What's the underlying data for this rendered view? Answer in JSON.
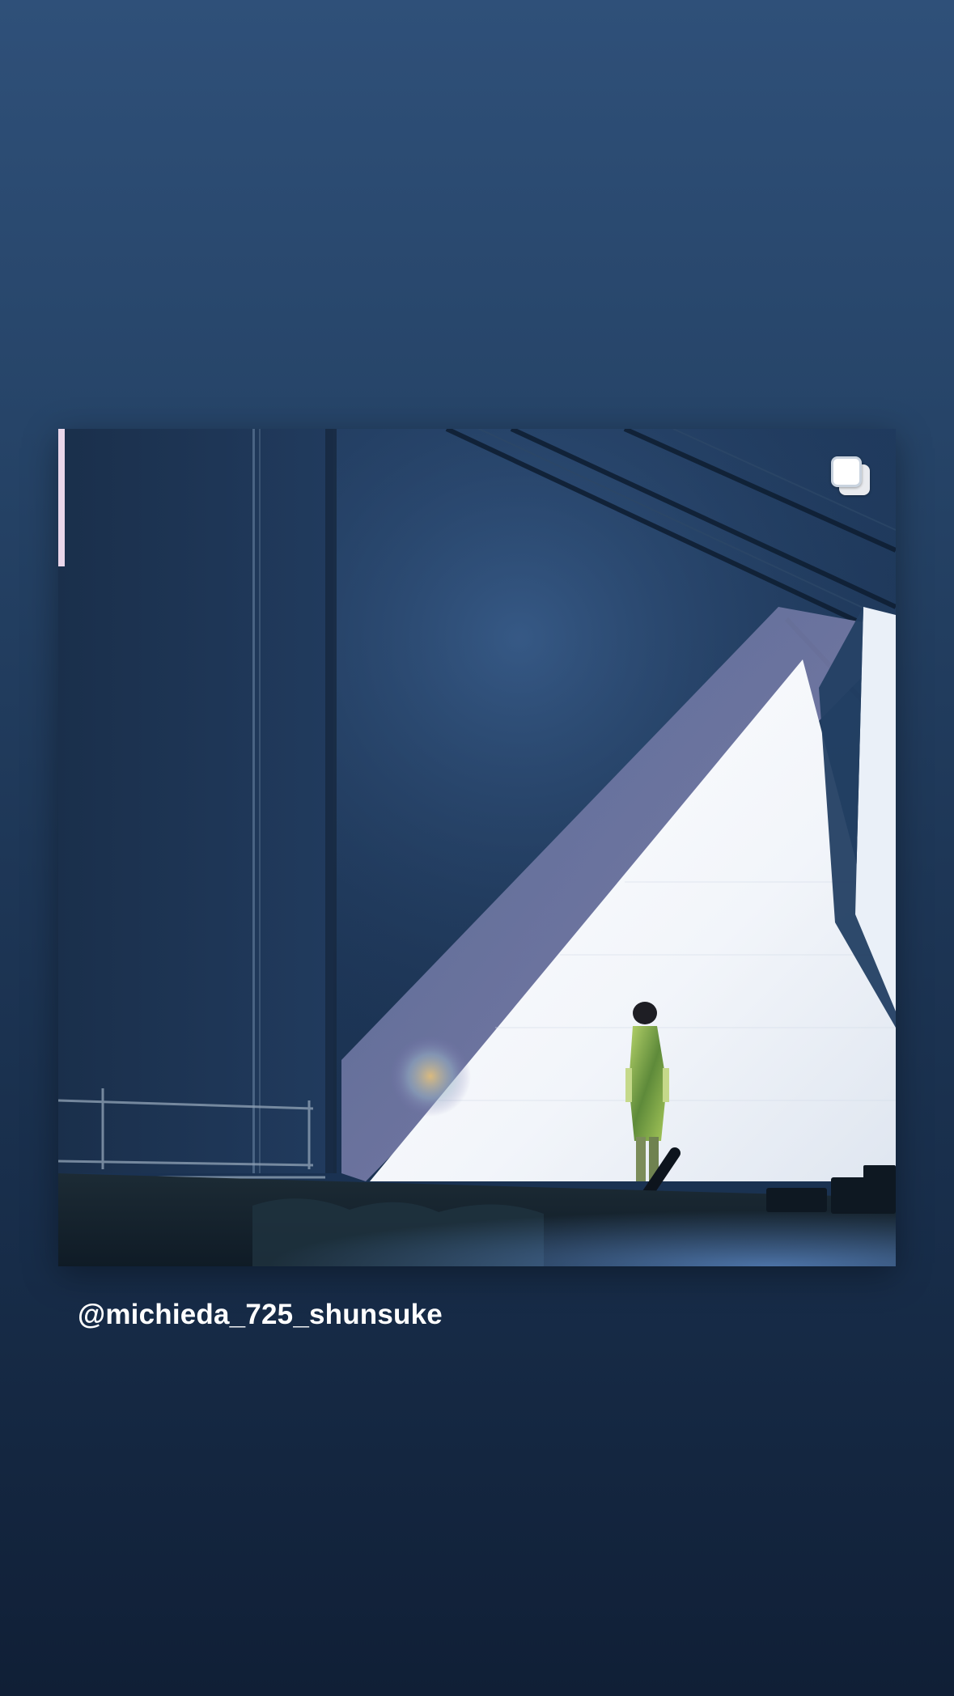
{
  "story": {
    "background_top": "#2f5079",
    "background_bottom": "#101f36",
    "post": {
      "image_icon": "concert-stage-photo",
      "carousel_icon": "carousel-multiple-icon"
    },
    "username": "@michieda_725_shunsuke"
  }
}
